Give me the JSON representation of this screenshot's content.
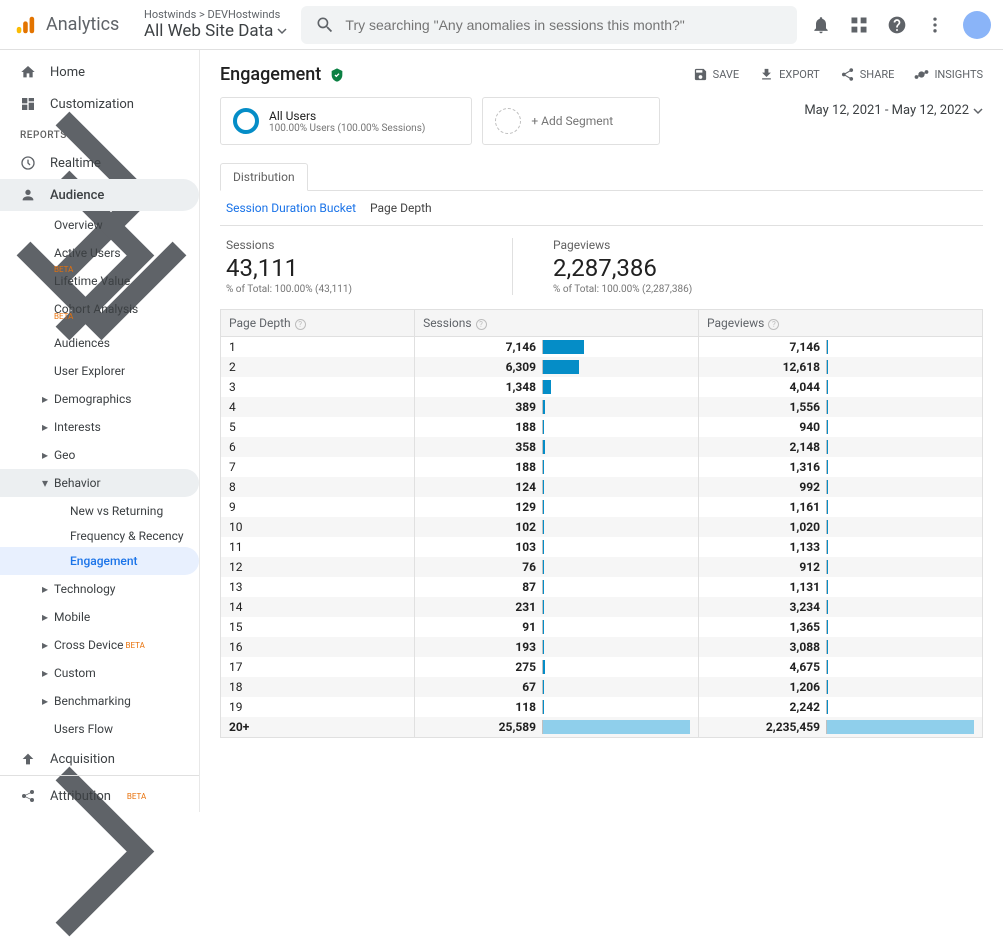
{
  "header": {
    "product": "Analytics",
    "crumb_top": "Hostwinds > DEVHostwinds",
    "crumb_bottom": "All Web Site Data",
    "search_placeholder": "Try searching \"Any anomalies in sessions this month?\""
  },
  "sidebar": {
    "home": "Home",
    "customization": "Customization",
    "reports_header": "REPORTS",
    "realtime": "Realtime",
    "audience": "Audience",
    "audience_items": {
      "overview": "Overview",
      "active_users": "Active Users",
      "lifetime_value": "Lifetime Value",
      "cohort": "Cohort Analysis",
      "audiences": "Audiences",
      "user_explorer": "User Explorer",
      "demographics": "Demographics",
      "interests": "Interests",
      "geo": "Geo",
      "behavior": "Behavior",
      "behavior_items": {
        "new_vs_returning": "New vs Returning",
        "frequency": "Frequency & Recency",
        "engagement": "Engagement"
      },
      "technology": "Technology",
      "mobile": "Mobile",
      "cross_device": "Cross Device",
      "custom": "Custom",
      "benchmarking": "Benchmarking",
      "users_flow": "Users Flow"
    },
    "acquisition": "Acquisition",
    "attribution": "Attribution",
    "beta": "BETA"
  },
  "main": {
    "title": "Engagement",
    "actions": {
      "save": "SAVE",
      "export": "EXPORT",
      "share": "SHARE",
      "insights": "INSIGHTS"
    },
    "segment_all": "All Users",
    "segment_all_sub": "100.00% Users (100.00% Sessions)",
    "segment_add": "+ Add Segment",
    "date_range": "May 12, 2021 - May 12, 2022",
    "tab_distribution": "Distribution",
    "subtab_session": "Session Duration Bucket",
    "subtab_depth": "Page Depth",
    "metrics": {
      "sessions_label": "Sessions",
      "sessions_value": "43,111",
      "sessions_sub": "% of Total: 100.00% (43,111)",
      "pageviews_label": "Pageviews",
      "pageviews_value": "2,287,386",
      "pageviews_sub": "% of Total: 100.00% (2,287,386)"
    },
    "table": {
      "col_depth": "Page Depth",
      "col_sessions": "Sessions",
      "col_pageviews": "Pageviews"
    }
  },
  "chart_data": {
    "type": "table",
    "columns": [
      "Page Depth",
      "Sessions",
      "Pageviews"
    ],
    "max_sessions": 25589,
    "max_pageviews": 2235459,
    "rows": [
      {
        "depth": "1",
        "sessions": "7,146",
        "sessions_pct": 27.9,
        "pageviews": "7,146",
        "pageviews_pct": 0.32
      },
      {
        "depth": "2",
        "sessions": "6,309",
        "sessions_pct": 24.7,
        "pageviews": "12,618",
        "pageviews_pct": 0.56
      },
      {
        "depth": "3",
        "sessions": "1,348",
        "sessions_pct": 5.3,
        "pageviews": "4,044",
        "pageviews_pct": 0.18
      },
      {
        "depth": "4",
        "sessions": "389",
        "sessions_pct": 1.5,
        "pageviews": "1,556",
        "pageviews_pct": 0.07
      },
      {
        "depth": "5",
        "sessions": "188",
        "sessions_pct": 0.7,
        "pageviews": "940",
        "pageviews_pct": 0.04
      },
      {
        "depth": "6",
        "sessions": "358",
        "sessions_pct": 1.4,
        "pageviews": "2,148",
        "pageviews_pct": 0.1
      },
      {
        "depth": "7",
        "sessions": "188",
        "sessions_pct": 0.7,
        "pageviews": "1,316",
        "pageviews_pct": 0.06
      },
      {
        "depth": "8",
        "sessions": "124",
        "sessions_pct": 0.5,
        "pageviews": "992",
        "pageviews_pct": 0.04
      },
      {
        "depth": "9",
        "sessions": "129",
        "sessions_pct": 0.5,
        "pageviews": "1,161",
        "pageviews_pct": 0.05
      },
      {
        "depth": "10",
        "sessions": "102",
        "sessions_pct": 0.4,
        "pageviews": "1,020",
        "pageviews_pct": 0.05
      },
      {
        "depth": "11",
        "sessions": "103",
        "sessions_pct": 0.4,
        "pageviews": "1,133",
        "pageviews_pct": 0.05
      },
      {
        "depth": "12",
        "sessions": "76",
        "sessions_pct": 0.3,
        "pageviews": "912",
        "pageviews_pct": 0.04
      },
      {
        "depth": "13",
        "sessions": "87",
        "sessions_pct": 0.3,
        "pageviews": "1,131",
        "pageviews_pct": 0.05
      },
      {
        "depth": "14",
        "sessions": "231",
        "sessions_pct": 0.9,
        "pageviews": "3,234",
        "pageviews_pct": 0.14
      },
      {
        "depth": "15",
        "sessions": "91",
        "sessions_pct": 0.4,
        "pageviews": "1,365",
        "pageviews_pct": 0.06
      },
      {
        "depth": "16",
        "sessions": "193",
        "sessions_pct": 0.8,
        "pageviews": "3,088",
        "pageviews_pct": 0.14
      },
      {
        "depth": "17",
        "sessions": "275",
        "sessions_pct": 1.1,
        "pageviews": "4,675",
        "pageviews_pct": 0.21
      },
      {
        "depth": "18",
        "sessions": "67",
        "sessions_pct": 0.3,
        "pageviews": "1,206",
        "pageviews_pct": 0.05
      },
      {
        "depth": "19",
        "sessions": "118",
        "sessions_pct": 0.5,
        "pageviews": "2,242",
        "pageviews_pct": 0.1
      },
      {
        "depth": "20+",
        "sessions": "25,589",
        "sessions_pct": 100.0,
        "pageviews": "2,235,459",
        "pageviews_pct": 100.0
      }
    ]
  }
}
